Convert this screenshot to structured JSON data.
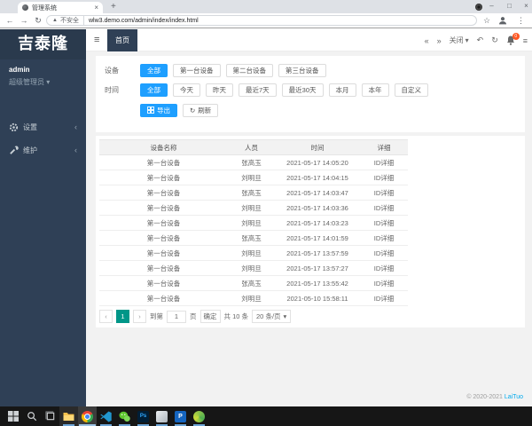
{
  "colors": {
    "accent_blue": "#1E9FFF",
    "pager_green": "#009688",
    "sidebar_bg": "#2f4056",
    "link_blue": "#01AAED",
    "badge_red": "#FF5722"
  },
  "icons": {
    "back": "←",
    "forward": "→",
    "reload": "↻",
    "warning": "▲",
    "star": "☆",
    "menu_dots": "⋮",
    "minimize": "–",
    "maximize": "□",
    "close": "×",
    "new_tab": "+",
    "tab_close": "×",
    "hamburger": "≡",
    "scroll_left": "«",
    "scroll_right": "»",
    "undo": "↶",
    "caret_down": "▾",
    "chevron_left": "‹",
    "chevron_right": "›",
    "menu_chevron": "‹"
  },
  "browser": {
    "tab_title": "管理系统",
    "security_label": "不安全",
    "url": "wlw3.demo.com/admin/index/index.html"
  },
  "sidebar": {
    "logo": "吉泰隆",
    "username": "admin",
    "role": "超级管理员",
    "menu": [
      {
        "label": "设置"
      },
      {
        "label": "维护"
      }
    ]
  },
  "topbar": {
    "home_tab": "首页",
    "close_label": "关闭",
    "notification_count": "0"
  },
  "filters": {
    "device_label": "设备",
    "device_options": [
      "全部",
      "第一台设备",
      "第二台设备",
      "第三台设备"
    ],
    "device_selected": "全部",
    "time_label": "时间",
    "time_options": [
      "全部",
      "今天",
      "昨天",
      "最近7天",
      "最近30天",
      "本月",
      "本年",
      "自定义"
    ],
    "time_selected": "全部",
    "export_label": "导出",
    "refresh_label": "刷新"
  },
  "table": {
    "columns": [
      "设备名称",
      "人员",
      "时间",
      "详细"
    ],
    "rows": [
      {
        "device": "第一台设备",
        "person": "张高玉",
        "time": "2021-05-17 14:05:20",
        "detail": "ID详细"
      },
      {
        "device": "第一台设备",
        "person": "刘明旦",
        "time": "2021-05-17 14:04:15",
        "detail": "ID详细"
      },
      {
        "device": "第一台设备",
        "person": "张高玉",
        "time": "2021-05-17 14:03:47",
        "detail": "ID详细"
      },
      {
        "device": "第一台设备",
        "person": "刘明旦",
        "time": "2021-05-17 14:03:36",
        "detail": "ID详细"
      },
      {
        "device": "第一台设备",
        "person": "刘明旦",
        "time": "2021-05-17 14:03:23",
        "detail": "ID详细"
      },
      {
        "device": "第一台设备",
        "person": "张高玉",
        "time": "2021-05-17 14:01:59",
        "detail": "ID详细"
      },
      {
        "device": "第一台设备",
        "person": "刘明旦",
        "time": "2021-05-17 13:57:59",
        "detail": "ID详细"
      },
      {
        "device": "第一台设备",
        "person": "刘明旦",
        "time": "2021-05-17 13:57:27",
        "detail": "ID详细"
      },
      {
        "device": "第一台设备",
        "person": "张高玉",
        "time": "2021-05-17 13:55:42",
        "detail": "ID详细"
      },
      {
        "device": "第一台设备",
        "person": "刘明旦",
        "time": "2021-05-10 15:58:11",
        "detail": "ID详细"
      }
    ]
  },
  "pagination": {
    "current_page": "1",
    "goto_label": "到第",
    "goto_value": "1",
    "page_unit": "页",
    "confirm_label": "确定",
    "total_label": "共 10 条",
    "per_page_label": "20 条/页"
  },
  "footer": {
    "copyright_prefix": "© 2020-2021",
    "copyright_link": "LaiTuo"
  },
  "taskbar": {
    "photoshop_label": "Ps",
    "p_app_label": "P"
  }
}
